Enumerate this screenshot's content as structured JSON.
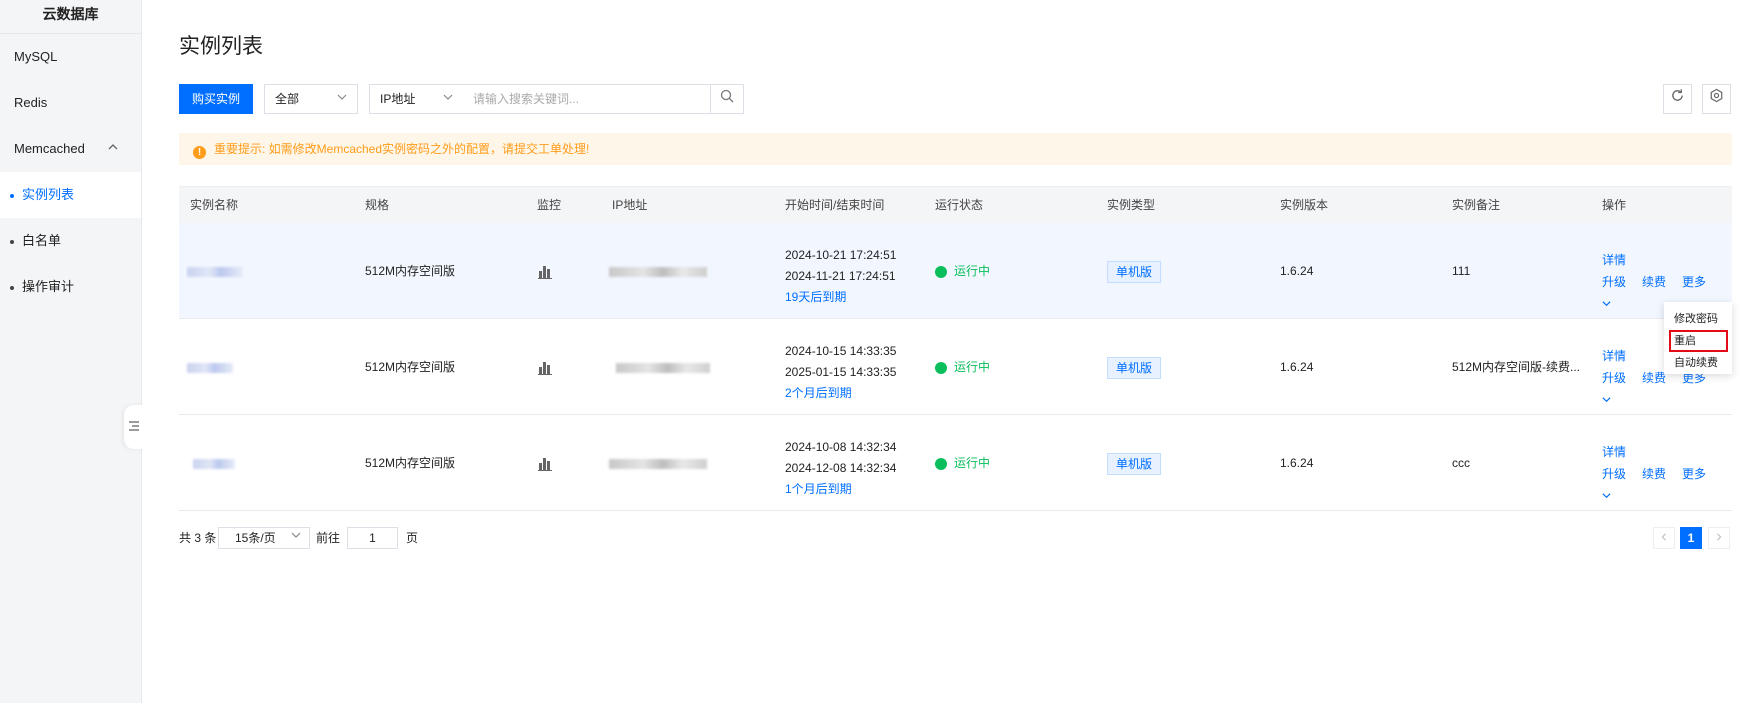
{
  "sidebar": {
    "title": "云数据库",
    "items": [
      {
        "label": "MySQL"
      },
      {
        "label": "Redis"
      },
      {
        "label": "Memcached"
      }
    ],
    "sub_items": [
      {
        "label": "实例列表",
        "active": true
      },
      {
        "label": "白名单",
        "active": false
      },
      {
        "label": "操作审计",
        "active": false
      }
    ]
  },
  "page": {
    "title": "实例列表"
  },
  "toolbar": {
    "buy_label": "购买实例",
    "filter_select": "全部",
    "field_select": "IP地址",
    "search_placeholder": "请输入搜索关键词..."
  },
  "notice": {
    "text": "重要提示: 如需修改Memcached实例密码之外的配置，请提交工单处理!"
  },
  "table": {
    "headers": [
      "实例名称",
      "规格",
      "监控",
      "IP地址",
      "开始时间/结束时间",
      "运行状态",
      "实例类型",
      "实例版本",
      "实例备注",
      "操作"
    ],
    "rows": [
      {
        "spec": "512M内存空间版",
        "start": "2024-10-21 17:24:51",
        "end": "2024-11-21 17:24:51",
        "expiry": "19天后到期",
        "status": "运行中",
        "type": "单机版",
        "version": "1.6.24",
        "remark": "111"
      },
      {
        "spec": "512M内存空间版",
        "start": "2024-10-15 14:33:35",
        "end": "2025-01-15 14:33:35",
        "expiry": "2个月后到期",
        "status": "运行中",
        "type": "单机版",
        "version": "1.6.24",
        "remark": "512M内存空间版-续费..."
      },
      {
        "spec": "512M内存空间版",
        "start": "2024-10-08 14:32:34",
        "end": "2024-12-08 14:32:34",
        "expiry": "1个月后到期",
        "status": "运行中",
        "type": "单机版",
        "version": "1.6.24",
        "remark": "ccc"
      }
    ],
    "ops": {
      "detail": "详情",
      "upgrade": "升级",
      "renew": "续费",
      "more": "更多"
    }
  },
  "dropdown": {
    "items": [
      "修改密码",
      "重启",
      "自动续费"
    ],
    "selected": "重启"
  },
  "pagination": {
    "total": "共 3 条",
    "page_size": "15条/页",
    "goto_label": "前往",
    "page_input": "1",
    "page_unit": "页",
    "current": "1"
  },
  "colors": {
    "primary": "#006eff",
    "warning": "#ff9c19",
    "success": "#0abf5b",
    "highlight": "#e30b17"
  }
}
